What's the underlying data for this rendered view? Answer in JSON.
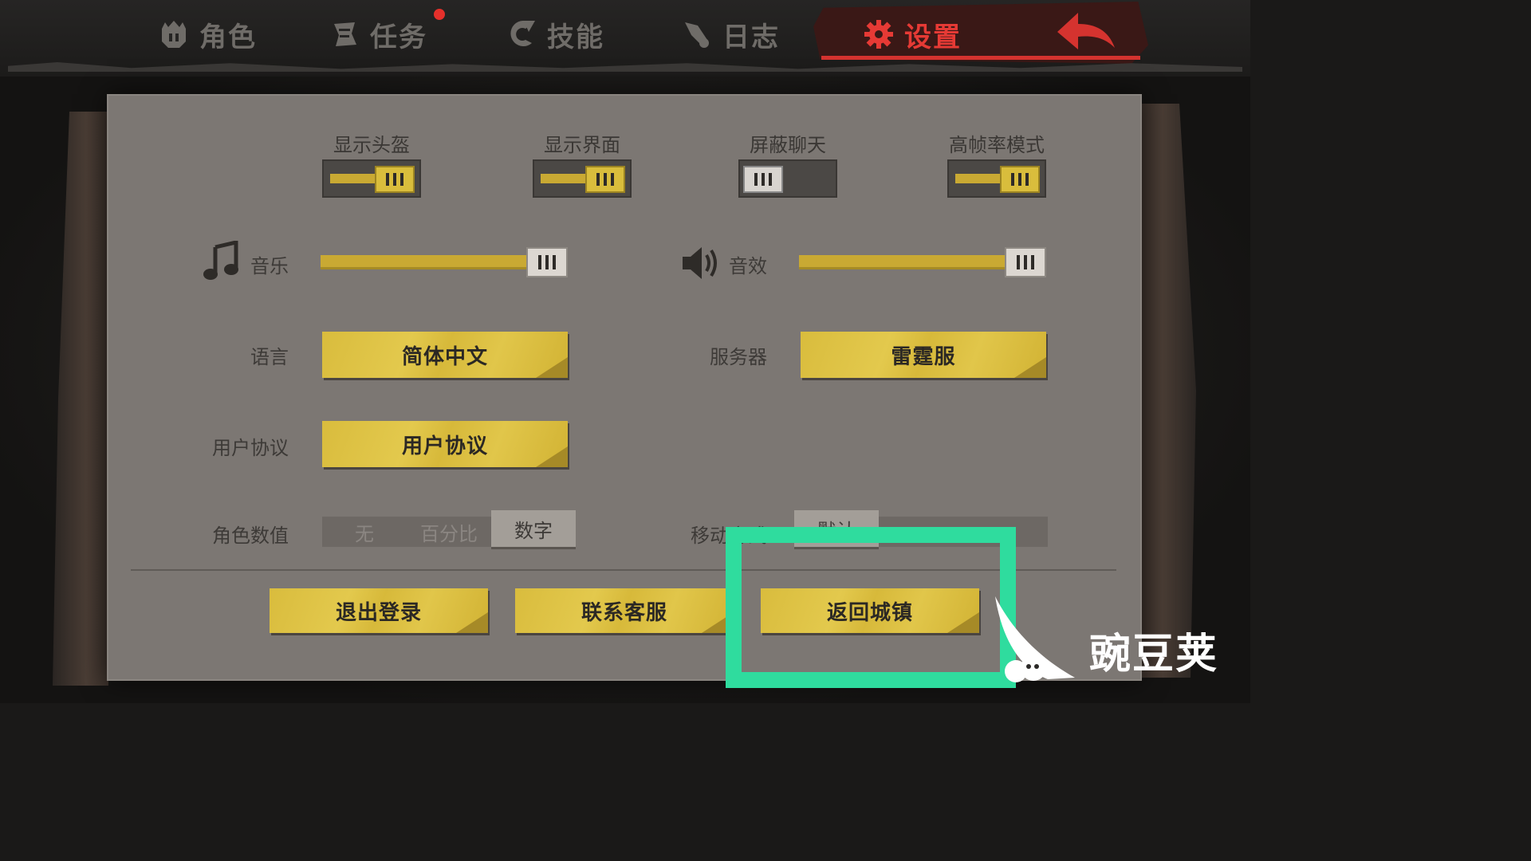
{
  "tabs": [
    {
      "label": "角色",
      "icon": "helmet-icon"
    },
    {
      "label": "任务",
      "icon": "scroll-icon"
    },
    {
      "label": "技能",
      "icon": "skill-icon"
    },
    {
      "label": "日志",
      "icon": "quill-icon"
    },
    {
      "label": "设置",
      "icon": "gear-icon",
      "active": true
    }
  ],
  "toggles": [
    {
      "label": "显示头盔",
      "on": true
    },
    {
      "label": "显示界面",
      "on": true
    },
    {
      "label": "屏蔽聊天",
      "on": false
    },
    {
      "label": "高帧率模式",
      "on": true
    }
  ],
  "sliders": {
    "music": {
      "label": "音乐",
      "level": 1.0
    },
    "sfx": {
      "label": "音效",
      "level": 1.0
    }
  },
  "language": {
    "label": "语言",
    "value": "简体中文"
  },
  "server": {
    "label": "服务器",
    "value": "雷霆服"
  },
  "agreement": {
    "label": "用户协议",
    "button": "用户协议"
  },
  "char_values": {
    "label": "角色数值",
    "options": [
      "无",
      "百分比",
      "数字"
    ],
    "selected": 2
  },
  "move_mode": {
    "label": "移动方式",
    "options": [
      "默认",
      "",
      ""
    ],
    "selected": 0
  },
  "bottom_buttons": {
    "logout": "退出登录",
    "contact": "联系客服",
    "return_town": "返回城镇"
  },
  "watermark": "豌豆荚",
  "colors": {
    "accent_yellow": "#d9bc3d",
    "active_tab_red": "#e63a35",
    "panel": "#7c7773",
    "highlight": "#2fdc9e"
  }
}
